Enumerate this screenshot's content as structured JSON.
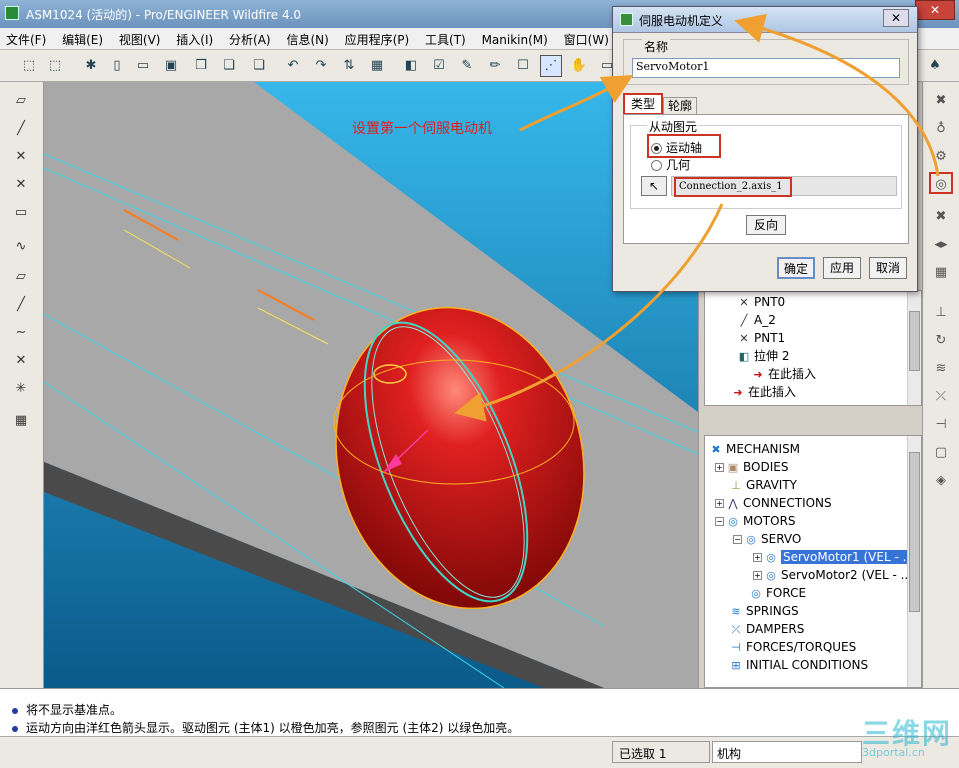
{
  "window": {
    "title": "ASM1024 (活动的) - Pro/ENGINEER Wildfire 4.0",
    "close_symbol": "✕"
  },
  "menu": [
    "文件(F)",
    "编辑(E)",
    "视图(V)",
    "插入(I)",
    "分析(A)",
    "信息(N)",
    "应用程序(P)",
    "工具(T)",
    "Manikin(M)",
    "窗口(W)",
    "帮"
  ],
  "annotation": "设置第一个伺服电动机",
  "dialog": {
    "title": "伺服电动机定义",
    "close_symbol": "✕",
    "name_label": "名称",
    "name_value": "ServoMotor1",
    "tabs": [
      "类型",
      "轮廓"
    ],
    "driven_group_label": "从动图元",
    "options": [
      "运动轴",
      "几何"
    ],
    "selected_option": "运动轴",
    "pick_symbol": "↖",
    "reference_value": "Connection_2.axis_1",
    "reverse_label": "反向",
    "ok_label": "确定",
    "apply_label": "应用",
    "cancel_label": "取消"
  },
  "model_tree": [
    {
      "label": "PNT0",
      "icon": "datum-point-icon"
    },
    {
      "label": "A_2",
      "icon": "datum-axis-icon"
    },
    {
      "label": "PNT1",
      "icon": "datum-point-icon"
    },
    {
      "label": "拉伸 2",
      "icon": "extrude-icon"
    },
    {
      "label": "在此插入",
      "icon": "insert-here-arrow-icon"
    },
    {
      "label": "在此插入",
      "icon": "insert-here-arrow-icon"
    }
  ],
  "mechanism_tree": {
    "root": "MECHANISM",
    "items": [
      {
        "label": "BODIES"
      },
      {
        "label": "GRAVITY"
      },
      {
        "label": "CONNECTIONS"
      },
      {
        "label": "MOTORS"
      },
      {
        "label": "SERVO"
      },
      {
        "label": "ServoMotor1 (VEL - ..."
      },
      {
        "label": "ServoMotor2 (VEL - ..."
      },
      {
        "label": "FORCE"
      },
      {
        "label": "SPRINGS"
      },
      {
        "label": "DAMPERS"
      },
      {
        "label": "FORCES/TORQUES"
      },
      {
        "label": "INITIAL CONDITIONS"
      }
    ],
    "selected": "ServoMotor1 (VEL - ..."
  },
  "messages": [
    "将不显示基准点。",
    "运动方向由洋红色箭头显示。驱动图元 (主体1) 以橙色加亮，参照图元 (主体2) 以绿色加亮。"
  ],
  "status": {
    "selected": "已选取 1",
    "filter": "机构"
  },
  "watermark": {
    "text": "三维网",
    "sub": "3dportal.cn"
  },
  "colors": {
    "highlight_box": "#cc3322",
    "viewport_bg": "#1f8fc0",
    "model_red": "#d41818",
    "annotation": "#e02020",
    "arrow": "#f0a030"
  }
}
